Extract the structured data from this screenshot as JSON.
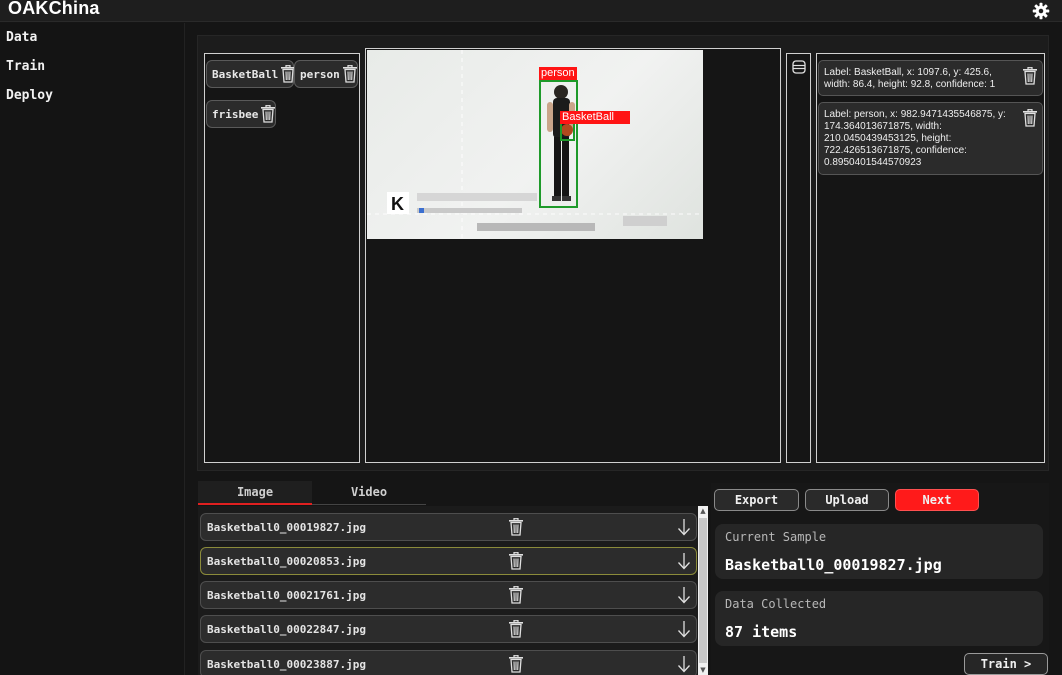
{
  "app": {
    "title": "OAKChina"
  },
  "sidebar": {
    "items": [
      {
        "label": "Data"
      },
      {
        "label": "Train"
      },
      {
        "label": "Deploy"
      }
    ]
  },
  "labels": [
    {
      "name": "BasketBall"
    },
    {
      "name": "person"
    },
    {
      "name": "frisbee"
    }
  ],
  "image": {
    "boxes": [
      {
        "label": "person"
      },
      {
        "label": "BasketBall"
      }
    ]
  },
  "annotations": [
    {
      "text": "Label: BasketBall, x: 1097.6, y: 425.6, width: 86.4, height: 92.8, confidence: 1"
    },
    {
      "text": "Label: person, x: 982.9471435546875, y: 174.364013671875, width: 210.0450439453125, height: 722.426513671875, confidence: 0.8950401544570923"
    }
  ],
  "tabs": [
    {
      "label": "Image"
    },
    {
      "label": "Video"
    }
  ],
  "files": [
    {
      "name": "Basketball0_00019827.jpg"
    },
    {
      "name": "Basketball0_00020853.jpg"
    },
    {
      "name": "Basketball0_00021761.jpg"
    },
    {
      "name": "Basketball0_00022847.jpg"
    },
    {
      "name": "Basketball0_00023887.jpg"
    }
  ],
  "actions": {
    "export": "Export",
    "upload": "Upload",
    "next": "Next",
    "train": "Train >"
  },
  "current_sample": {
    "label": "Current Sample",
    "value": "Basketball0_00019827.jpg"
  },
  "data_collected": {
    "label": "Data Collected",
    "value": "87 items"
  },
  "colors": {
    "accent": "#ff1a1a",
    "box": "#1e9a2a"
  }
}
